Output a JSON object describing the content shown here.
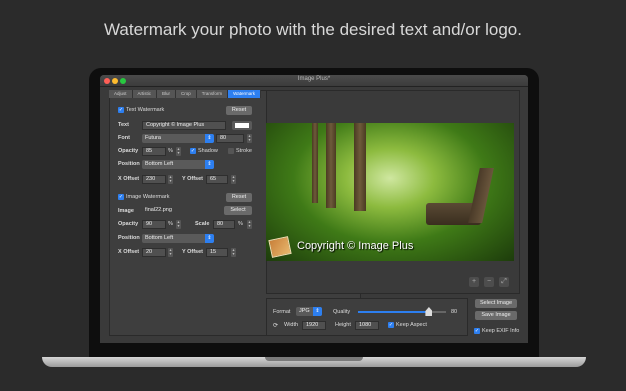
{
  "headline": "Watermark your photo with the desired text and/or logo.",
  "window": {
    "title": "Image Plus*"
  },
  "tabs": [
    "Adjust",
    "Artistic",
    "Blur",
    "Crop",
    "Transform",
    "Watermark"
  ],
  "active_tab": "Watermark",
  "text_watermark": {
    "checkbox_label": "Text Watermark",
    "checked": true,
    "reset_label": "Reset",
    "text_label": "Text",
    "text_value": "Copyright © Image Plus",
    "font_label": "Font",
    "font_value": "Futura",
    "font_size": "80",
    "opacity_label": "Opacity",
    "opacity_value": "85",
    "percent": "%",
    "shadow_label": "Shadow",
    "shadow_checked": true,
    "stroke_label": "Stroke",
    "stroke_checked": false,
    "position_label": "Position",
    "position_value": "Bottom Left",
    "x_offset_label": "X Offset",
    "x_offset_value": "230",
    "y_offset_label": "Y Offset",
    "y_offset_value": "65"
  },
  "image_watermark": {
    "checkbox_label": "Image Watermark",
    "checked": true,
    "reset_label": "Reset",
    "image_label": "Image",
    "image_value": "final22.png",
    "select_label": "Select",
    "opacity_label": "Opacity",
    "opacity_value": "90",
    "percent": "%",
    "scale_label": "Scale",
    "scale_value": "80",
    "position_label": "Position",
    "position_value": "Bottom Left",
    "x_offset_label": "X Offset",
    "x_offset_value": "20",
    "y_offset_label": "Y Offset",
    "y_offset_value": "15"
  },
  "preview": {
    "watermark_text": "Copyright © Image Plus"
  },
  "zoom_controls": [
    "+",
    "−",
    "⤢"
  ],
  "export": {
    "format_label": "Format",
    "format_value": "JPG",
    "quality_label": "Quality",
    "quality_value": "80",
    "quality_fraction": 0.8,
    "width_label": "Width",
    "width_value": "1920",
    "height_label": "Height",
    "height_value": "1080",
    "keep_aspect_label": "Keep Aspect",
    "keep_aspect_checked": true,
    "select_image_label": "Select Image",
    "save_image_label": "Save Image",
    "keep_exif_label": "Keep EXIF Info",
    "keep_exif_checked": true
  },
  "colors": {
    "accent": "#2d7ff0",
    "watermark_color": "#ffffff"
  }
}
